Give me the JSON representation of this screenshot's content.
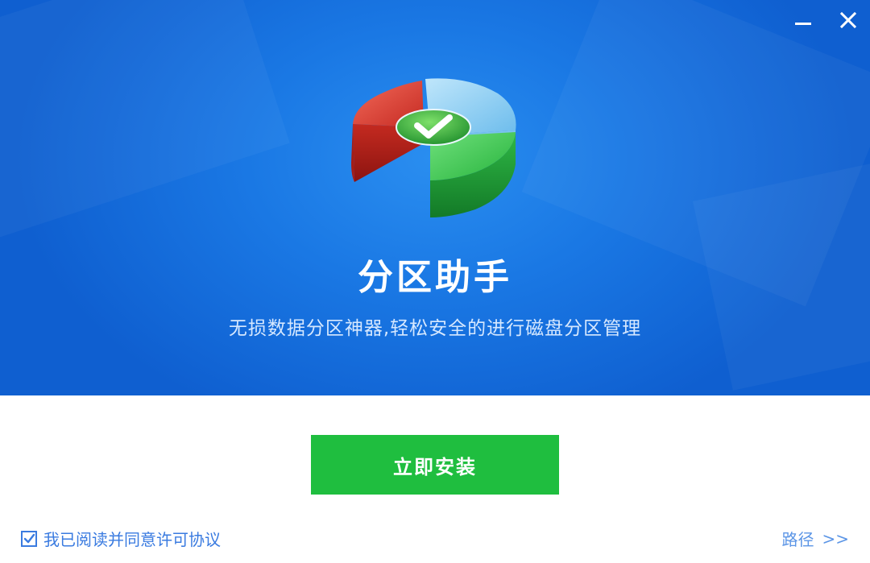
{
  "window": {
    "minimize_icon": "minimize-icon",
    "close_icon": "close-icon"
  },
  "hero": {
    "logo_icon": "partition-pie-check-icon",
    "title": "分区助手",
    "subtitle": "无损数据分区神器,轻松安全的进行磁盘分区管理"
  },
  "actions": {
    "install_label": "立即安装",
    "agree_label": "我已阅读并同意许可协议",
    "agree_checked": true,
    "path_label": "路径",
    "path_arrow": ">>"
  },
  "colors": {
    "hero_blue": "#1a78e4",
    "install_green": "#1fbe3f",
    "link_blue": "#3a7be0"
  }
}
